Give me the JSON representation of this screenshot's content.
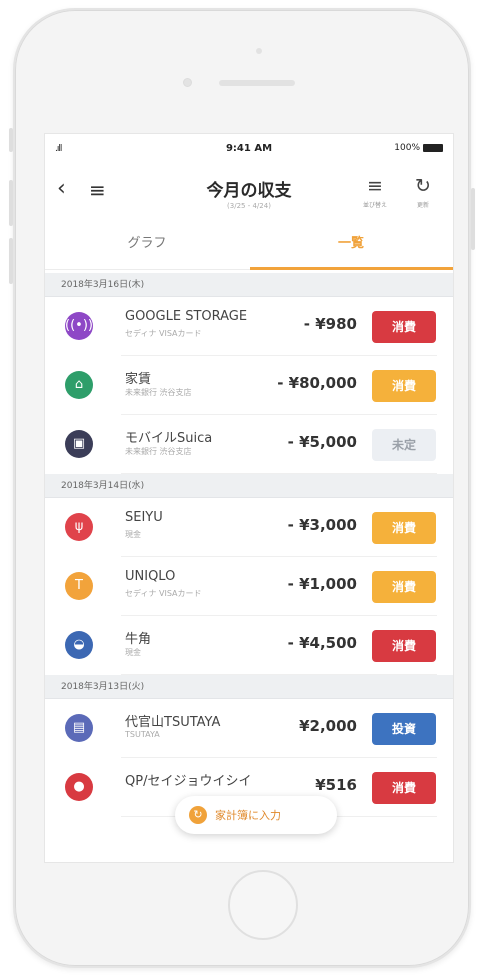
{
  "status_bar": {
    "signal": ".ıll",
    "time": "9:41 AM",
    "battery": "100%"
  },
  "header": {
    "back_icon": "‹",
    "menu_icon": "≡",
    "title": "今月の収支",
    "subtitle": "(3/25 - 4/24)",
    "filter_icon": "≡",
    "filter_label": "並び替え",
    "refresh_icon": "↻",
    "refresh_label": "更新"
  },
  "tabs": [
    {
      "label": "グラフ",
      "active": false
    },
    {
      "label": "一覧",
      "active": true
    }
  ],
  "colors": {
    "accent": "#f2a33b",
    "consumption_red": "#d83a41",
    "consumption_orange": "#f5b13b",
    "undecided": "#eceff3",
    "investment": "#3d73c0"
  },
  "sections": [
    {
      "date": "2018年3月16日(木)",
      "rows": [
        {
          "icon": "google-storage-icon",
          "glyph": "((•))",
          "icon_color": "#8e48c6",
          "title": "GOOGLE STORAGE",
          "sub": "セディナ VISAカード",
          "amount": "- ¥980",
          "badge": "消費",
          "badge_color": "#d83a41",
          "badge_text_color": "#ffffff"
        },
        {
          "icon": "house-icon",
          "glyph": "⌂",
          "icon_color": "#2e9e6a",
          "title": "家賃",
          "sub": "未来銀行 渋谷支店",
          "amount": "- ¥80,000",
          "badge": "消費",
          "badge_color": "#f5b13b",
          "badge_text_color": "#ffffff"
        },
        {
          "icon": "train-icon",
          "glyph": "▣",
          "icon_color": "#3b3d58",
          "title": "モバイルSuica",
          "sub": "未来銀行 渋谷支店",
          "amount": "- ¥5,000",
          "badge": "未定",
          "badge_color": "#eceff3",
          "badge_text_color": "#9aa0a8"
        }
      ]
    },
    {
      "date": "2018年3月14日(水)",
      "rows": [
        {
          "icon": "fork-knife-icon",
          "glyph": "ψ",
          "icon_color": "#e0434b",
          "title": "SEIYU",
          "sub": "現金",
          "amount": "- ¥3,000",
          "badge": "消費",
          "badge_color": "#f5b13b",
          "badge_text_color": "#ffffff"
        },
        {
          "icon": "tshirt-icon",
          "glyph": "T",
          "icon_color": "#f2a33b",
          "title": "UNIQLO",
          "sub": "セディナ VISAカード",
          "amount": "- ¥1,000",
          "badge": "消費",
          "badge_color": "#f5b13b",
          "badge_text_color": "#ffffff"
        },
        {
          "icon": "bowl-icon",
          "glyph": "◒",
          "icon_color": "#3c68b3",
          "title": "牛角",
          "sub": "現金",
          "amount": "- ¥4,500",
          "badge": "消費",
          "badge_color": "#d83a41",
          "badge_text_color": "#ffffff"
        }
      ]
    },
    {
      "date": "2018年3月13日(火)",
      "rows": [
        {
          "icon": "book-icon",
          "glyph": "▤",
          "icon_color": "#5b6ab8",
          "title": "代官山TSUTAYA",
          "sub": "TSUTAYA",
          "amount": "¥2,000",
          "badge": "投資",
          "badge_color": "#3d73c0",
          "badge_text_color": "#ffffff"
        },
        {
          "icon": "shop-icon",
          "glyph": "●",
          "icon_color": "#d83a41",
          "title": "QP/セイジョウイシイ",
          "sub": "",
          "amount": "¥516",
          "badge": "消費",
          "badge_color": "#d83a41",
          "badge_text_color": "#ffffff"
        }
      ]
    }
  ],
  "fab": {
    "icon": "refresh-orange-icon",
    "glyph": "↻",
    "label": "家計簿に入力"
  }
}
